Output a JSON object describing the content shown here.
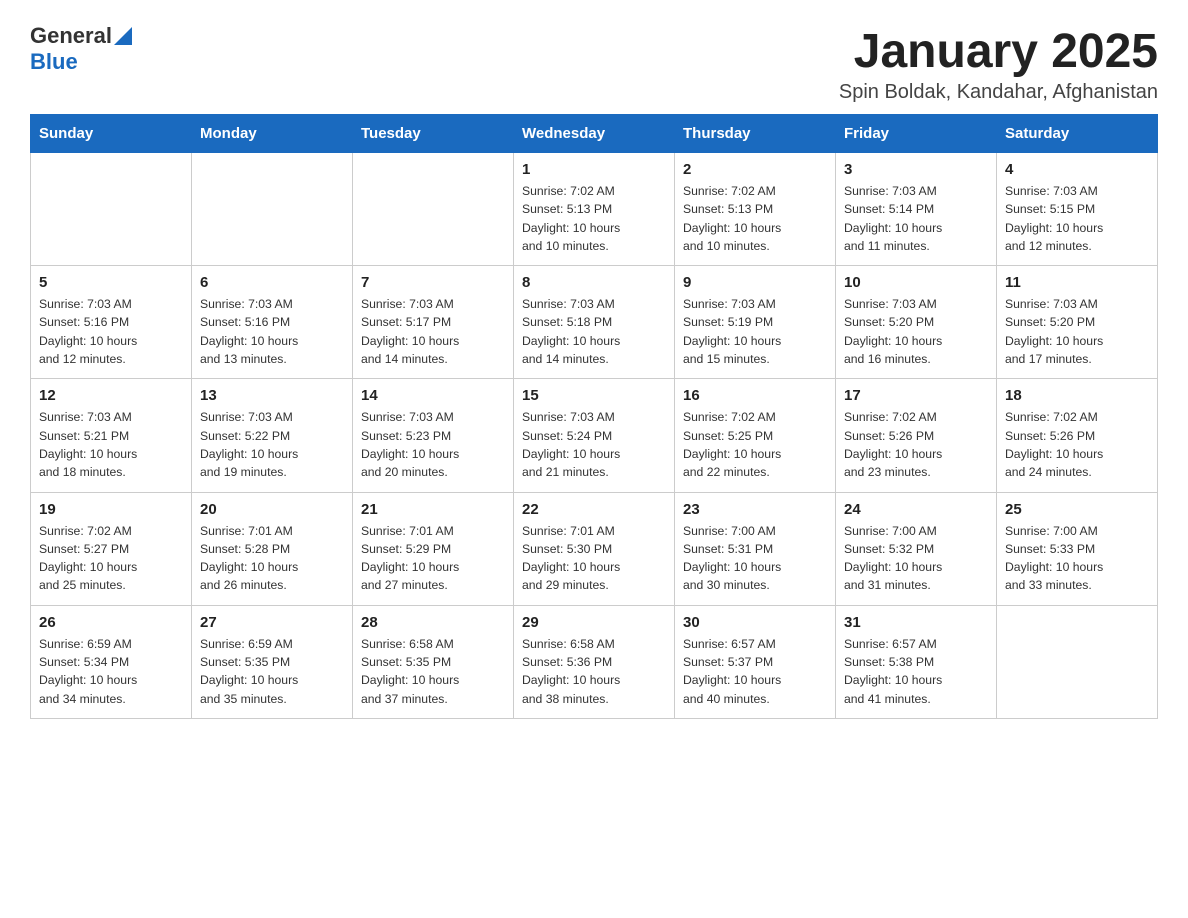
{
  "header": {
    "logo_general": "General",
    "logo_blue": "Blue",
    "month_title": "January 2025",
    "subtitle": "Spin Boldak, Kandahar, Afghanistan"
  },
  "weekdays": [
    "Sunday",
    "Monday",
    "Tuesday",
    "Wednesday",
    "Thursday",
    "Friday",
    "Saturday"
  ],
  "weeks": [
    [
      {
        "day": "",
        "info": ""
      },
      {
        "day": "",
        "info": ""
      },
      {
        "day": "",
        "info": ""
      },
      {
        "day": "1",
        "info": "Sunrise: 7:02 AM\nSunset: 5:13 PM\nDaylight: 10 hours\nand 10 minutes."
      },
      {
        "day": "2",
        "info": "Sunrise: 7:02 AM\nSunset: 5:13 PM\nDaylight: 10 hours\nand 10 minutes."
      },
      {
        "day": "3",
        "info": "Sunrise: 7:03 AM\nSunset: 5:14 PM\nDaylight: 10 hours\nand 11 minutes."
      },
      {
        "day": "4",
        "info": "Sunrise: 7:03 AM\nSunset: 5:15 PM\nDaylight: 10 hours\nand 12 minutes."
      }
    ],
    [
      {
        "day": "5",
        "info": "Sunrise: 7:03 AM\nSunset: 5:16 PM\nDaylight: 10 hours\nand 12 minutes."
      },
      {
        "day": "6",
        "info": "Sunrise: 7:03 AM\nSunset: 5:16 PM\nDaylight: 10 hours\nand 13 minutes."
      },
      {
        "day": "7",
        "info": "Sunrise: 7:03 AM\nSunset: 5:17 PM\nDaylight: 10 hours\nand 14 minutes."
      },
      {
        "day": "8",
        "info": "Sunrise: 7:03 AM\nSunset: 5:18 PM\nDaylight: 10 hours\nand 14 minutes."
      },
      {
        "day": "9",
        "info": "Sunrise: 7:03 AM\nSunset: 5:19 PM\nDaylight: 10 hours\nand 15 minutes."
      },
      {
        "day": "10",
        "info": "Sunrise: 7:03 AM\nSunset: 5:20 PM\nDaylight: 10 hours\nand 16 minutes."
      },
      {
        "day": "11",
        "info": "Sunrise: 7:03 AM\nSunset: 5:20 PM\nDaylight: 10 hours\nand 17 minutes."
      }
    ],
    [
      {
        "day": "12",
        "info": "Sunrise: 7:03 AM\nSunset: 5:21 PM\nDaylight: 10 hours\nand 18 minutes."
      },
      {
        "day": "13",
        "info": "Sunrise: 7:03 AM\nSunset: 5:22 PM\nDaylight: 10 hours\nand 19 minutes."
      },
      {
        "day": "14",
        "info": "Sunrise: 7:03 AM\nSunset: 5:23 PM\nDaylight: 10 hours\nand 20 minutes."
      },
      {
        "day": "15",
        "info": "Sunrise: 7:03 AM\nSunset: 5:24 PM\nDaylight: 10 hours\nand 21 minutes."
      },
      {
        "day": "16",
        "info": "Sunrise: 7:02 AM\nSunset: 5:25 PM\nDaylight: 10 hours\nand 22 minutes."
      },
      {
        "day": "17",
        "info": "Sunrise: 7:02 AM\nSunset: 5:26 PM\nDaylight: 10 hours\nand 23 minutes."
      },
      {
        "day": "18",
        "info": "Sunrise: 7:02 AM\nSunset: 5:26 PM\nDaylight: 10 hours\nand 24 minutes."
      }
    ],
    [
      {
        "day": "19",
        "info": "Sunrise: 7:02 AM\nSunset: 5:27 PM\nDaylight: 10 hours\nand 25 minutes."
      },
      {
        "day": "20",
        "info": "Sunrise: 7:01 AM\nSunset: 5:28 PM\nDaylight: 10 hours\nand 26 minutes."
      },
      {
        "day": "21",
        "info": "Sunrise: 7:01 AM\nSunset: 5:29 PM\nDaylight: 10 hours\nand 27 minutes."
      },
      {
        "day": "22",
        "info": "Sunrise: 7:01 AM\nSunset: 5:30 PM\nDaylight: 10 hours\nand 29 minutes."
      },
      {
        "day": "23",
        "info": "Sunrise: 7:00 AM\nSunset: 5:31 PM\nDaylight: 10 hours\nand 30 minutes."
      },
      {
        "day": "24",
        "info": "Sunrise: 7:00 AM\nSunset: 5:32 PM\nDaylight: 10 hours\nand 31 minutes."
      },
      {
        "day": "25",
        "info": "Sunrise: 7:00 AM\nSunset: 5:33 PM\nDaylight: 10 hours\nand 33 minutes."
      }
    ],
    [
      {
        "day": "26",
        "info": "Sunrise: 6:59 AM\nSunset: 5:34 PM\nDaylight: 10 hours\nand 34 minutes."
      },
      {
        "day": "27",
        "info": "Sunrise: 6:59 AM\nSunset: 5:35 PM\nDaylight: 10 hours\nand 35 minutes."
      },
      {
        "day": "28",
        "info": "Sunrise: 6:58 AM\nSunset: 5:35 PM\nDaylight: 10 hours\nand 37 minutes."
      },
      {
        "day": "29",
        "info": "Sunrise: 6:58 AM\nSunset: 5:36 PM\nDaylight: 10 hours\nand 38 minutes."
      },
      {
        "day": "30",
        "info": "Sunrise: 6:57 AM\nSunset: 5:37 PM\nDaylight: 10 hours\nand 40 minutes."
      },
      {
        "day": "31",
        "info": "Sunrise: 6:57 AM\nSunset: 5:38 PM\nDaylight: 10 hours\nand 41 minutes."
      },
      {
        "day": "",
        "info": ""
      }
    ]
  ]
}
